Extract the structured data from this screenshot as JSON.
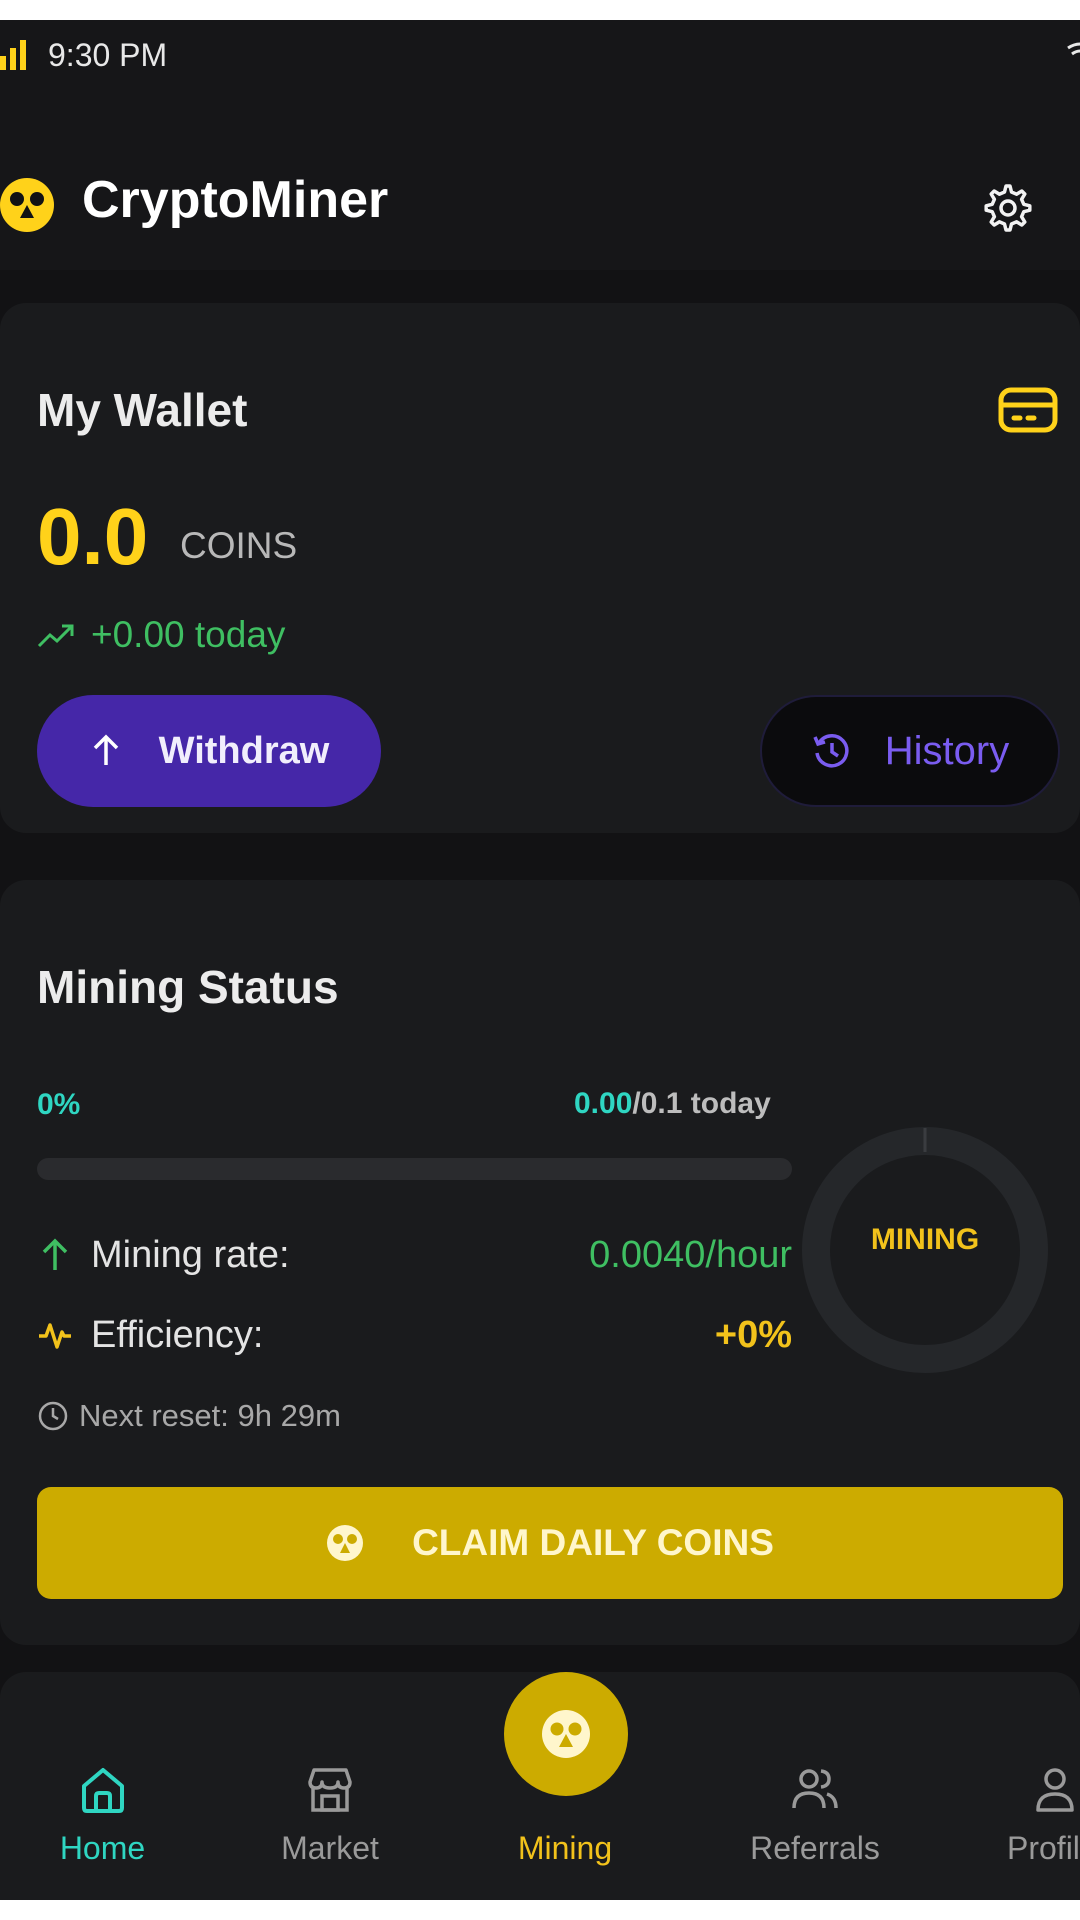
{
  "status_bar": {
    "time": "9:30 PM"
  },
  "header": {
    "app_name": "CryptoMiner"
  },
  "wallet": {
    "title": "My Wallet",
    "balance": "0.0",
    "unit": "COINS",
    "change_today": "+0.00 today",
    "withdraw_label": "Withdraw",
    "history_label": "History"
  },
  "mining": {
    "title": "Mining Status",
    "percent_text": "0%",
    "progress_fraction": 0,
    "mined_today": "0.00",
    "daily_limit": "/0.1 today",
    "rate_label": "Mining rate:",
    "rate_value": "0.0040/hour",
    "efficiency_label": "Efficiency:",
    "efficiency_value": "+0%",
    "next_reset": "Next reset: 9h 29m",
    "gauge_label": "MINING",
    "claim_label": "CLAIM DAILY COINS"
  },
  "bottom_nav": {
    "items": [
      {
        "label": "Home",
        "icon": "home-icon",
        "active": true
      },
      {
        "label": "Market",
        "icon": "store-icon"
      },
      {
        "label": "Mining",
        "icon": "mining-icon"
      },
      {
        "label": "Referrals",
        "icon": "users-icon"
      },
      {
        "label": "Profile",
        "icon": "user-icon"
      }
    ]
  },
  "colors": {
    "background": "#121214",
    "card": "#1a1b1d",
    "accent_yellow": "#ccab00",
    "balance_yellow": "#ffd21a",
    "teal": "#2fd6c2",
    "green": "#3fbf62",
    "purple": "#4527a8",
    "purple_text": "#7a5cf0"
  }
}
